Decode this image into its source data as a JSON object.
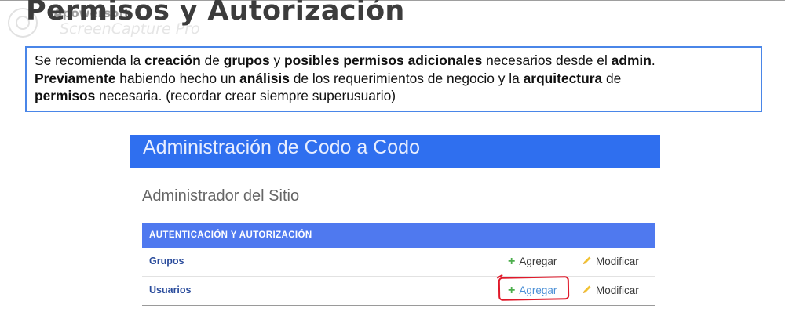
{
  "page": {
    "title": "Permisos y Autorización"
  },
  "watermark": {
    "line1": "Apowersoft",
    "line2": "ScreenCapture Pro"
  },
  "note": {
    "parts": {
      "p1": "Se recomienda la ",
      "b1": "creación",
      "p2": " de ",
      "b2": "grupos",
      "p3": " y ",
      "b3": "posibles permisos adicionales",
      "p4": " necesarios desde el ",
      "b4": "admin",
      "p5": ".",
      "b5": "Previamente",
      "p6": " habiendo hecho un ",
      "b6": "análisis",
      "p7": " de los requerimientos de negocio y la ",
      "b7": "arquitectura",
      "p8": " de",
      "b8": "permisos",
      "p9": " necesaria. (recordar crear siempre superusuario)"
    }
  },
  "django_admin": {
    "branding": "Administración de Codo a Codo",
    "site_heading": "Administrador del Sitio",
    "module_caption": "AUTENTICACIÓN Y AUTORIZACIÓN",
    "rows": [
      {
        "label": "Grupos",
        "add": "Agregar",
        "change": "Modificar"
      },
      {
        "label": "Usuarios",
        "add": "Agregar",
        "change": "Modificar"
      }
    ],
    "icons": {
      "add": "plus-icon",
      "change": "pencil-icon"
    }
  },
  "colors": {
    "branding_bg": "#2f6fef",
    "caption_bg": "#4f79ef",
    "note_border": "#4a86e8",
    "highlight": "#e0192a",
    "add_icon": "#4cae4c"
  }
}
